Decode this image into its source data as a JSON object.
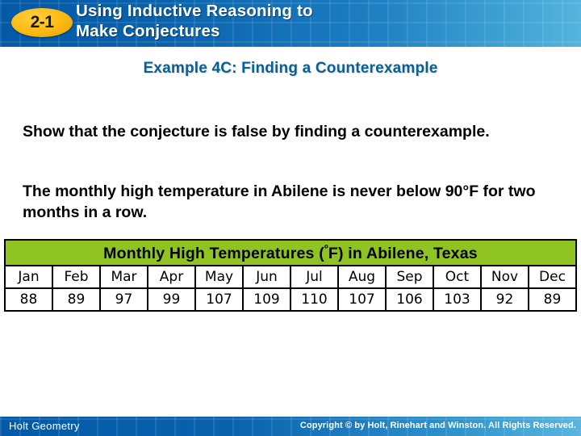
{
  "header": {
    "badge": "2-1",
    "title": "Using Inductive Reasoning to\nMake Conjectures",
    "badge_color": "#fdbd18",
    "bar_color_left": "#0359a6",
    "bar_color_right": "#55b4dd"
  },
  "example": {
    "title": "Example 4C: Finding a Counterexample",
    "title_color": "#0d5f8f"
  },
  "body": {
    "instruction": "Show that the conjecture is false by finding a counterexample.",
    "conjecture": "The monthly high temperature in Abilene is never below 90°F for two months in a row."
  },
  "table": {
    "banner_prefix": "Monthly High Temperatures (",
    "banner_degree": "º",
    "banner_suffix": "F) in Abilene, Texas",
    "banner_full": "Monthly High Temperatures (ºF) in Abilene, Texas",
    "banner_color": "#8fc322",
    "months": [
      "Jan",
      "Feb",
      "Mar",
      "Apr",
      "May",
      "Jun",
      "Jul",
      "Aug",
      "Sep",
      "Oct",
      "Nov",
      "Dec"
    ],
    "temperatures": [
      88,
      89,
      97,
      99,
      107,
      109,
      110,
      107,
      106,
      103,
      92,
      89
    ]
  },
  "footer": {
    "left": "Holt Geometry",
    "right": "Copyright © by Holt, Rinehart and Winston. All Rights Reserved."
  }
}
